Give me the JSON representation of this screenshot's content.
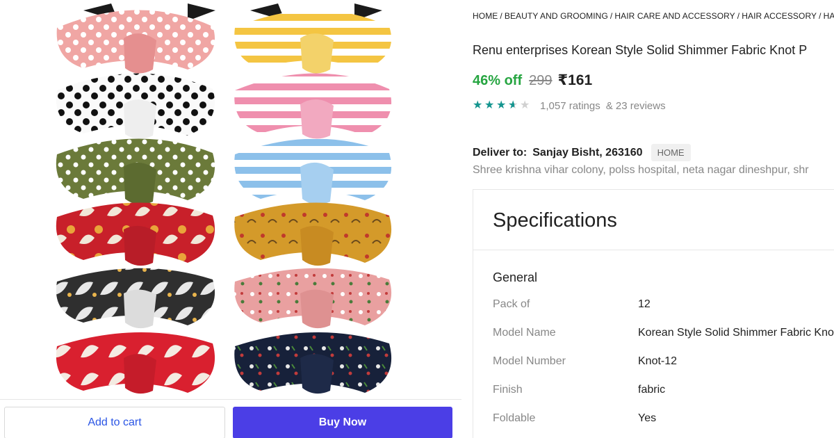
{
  "breadcrumb": [
    "HOME",
    "BEAUTY AND GROOMING",
    "HAIR CARE AND ACCESSORY",
    "HAIR ACCESSORY",
    "HAIR B"
  ],
  "product": {
    "title": "Renu enterprises Korean Style Solid Shimmer Fabric Knot P",
    "discount": "46% off",
    "mrp": "299",
    "price": "₹161",
    "rating_value": 3.5,
    "rating_max": 5,
    "ratings_text": "1,057 ratings",
    "reviews_text": "& 23 reviews"
  },
  "delivery": {
    "label": "Deliver to:",
    "name": "Sanjay Bisht, 263160",
    "badge": "HOME",
    "address": "Shree krishna vihar colony, polss hospital, neta nagar dineshpur, shr"
  },
  "actions": {
    "add_to_cart": "Add to cart",
    "buy_now": "Buy Now"
  },
  "specifications": {
    "title": "Specifications",
    "section": "General",
    "rows": [
      {
        "key": "Pack of",
        "value": "12"
      },
      {
        "key": "Model Name",
        "value": "Korean Style Solid Shimmer Fabric Knot"
      },
      {
        "key": "Model Number",
        "value": "Knot-12"
      },
      {
        "key": "Finish",
        "value": "fabric"
      },
      {
        "key": "Foldable",
        "value": "Yes"
      }
    ]
  },
  "colors": {
    "accent_green": "#26a541",
    "star_green": "#14958f",
    "buy_button": "#4b3ee6",
    "cart_text": "#2a55e5"
  }
}
